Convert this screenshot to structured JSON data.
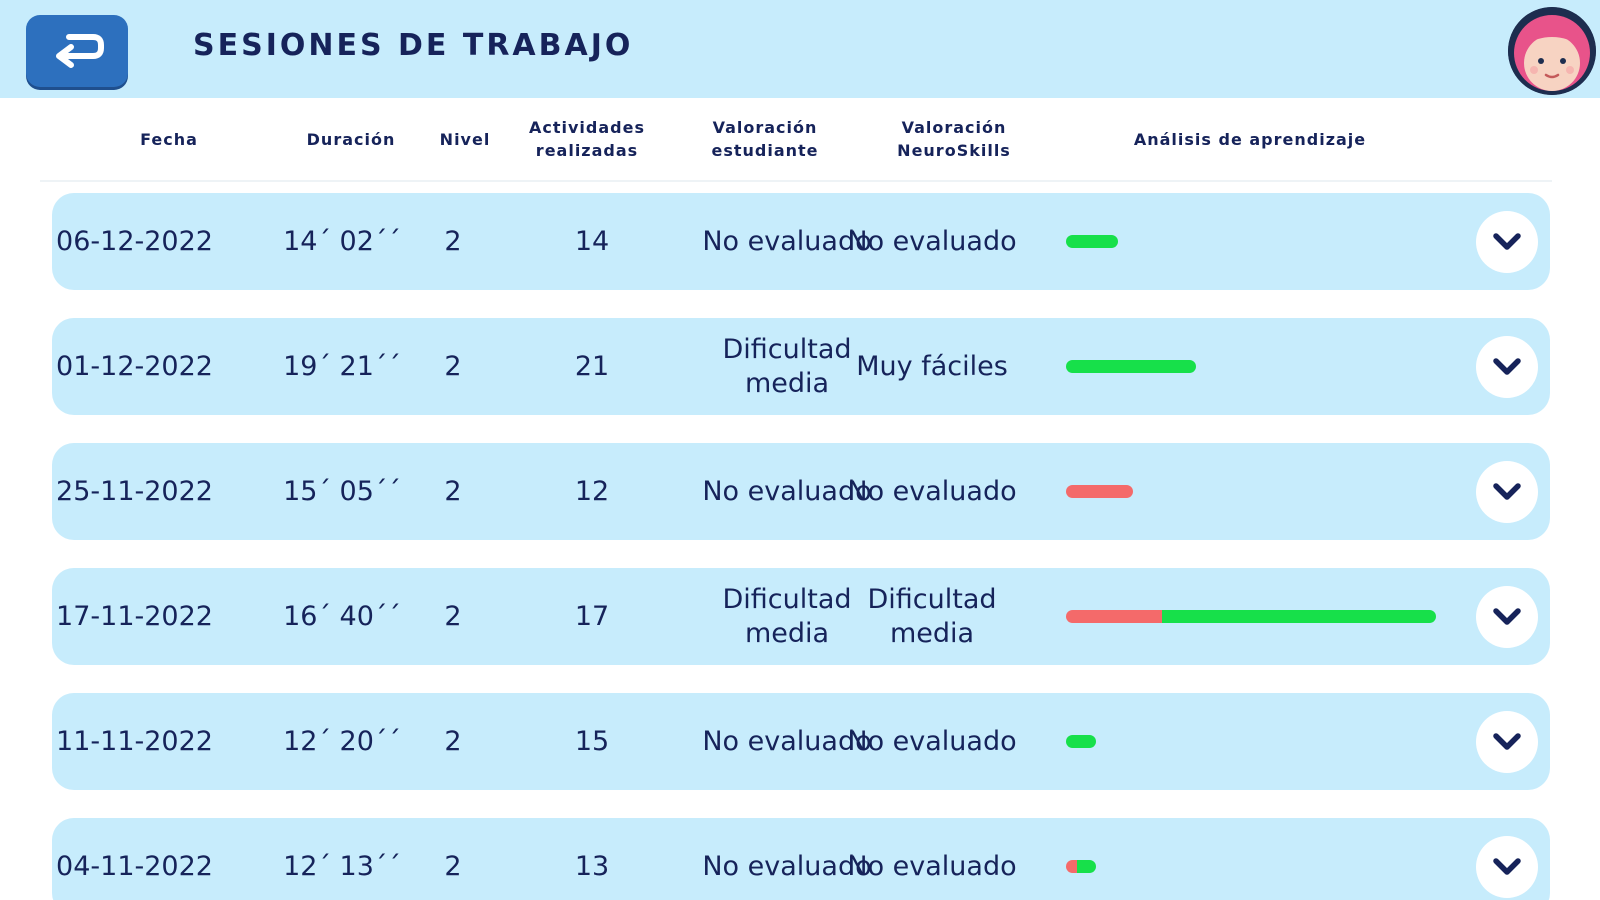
{
  "header": {
    "title": "SESIONES DE TRABAJO",
    "back_icon": "return-arrow-icon",
    "avatar_icon": "girl-avatar-icon"
  },
  "columns": {
    "fecha": "Fecha",
    "duracion": "Duración",
    "nivel": "Nivel",
    "actividades": "Actividades realizadas",
    "valoracion_estudiante": "Valoración estudiante",
    "valoracion_neuroskills": "Valoración NeuroSkills",
    "analisis": "Análisis de aprendizaje"
  },
  "colors": {
    "header_bg": "#c7ecfc",
    "row_bg": "#c7ecfc",
    "accent_blue": "#2d70be",
    "text": "#16235a",
    "bar_green": "#17e04a",
    "bar_red": "#f46a6a"
  },
  "sessions": [
    {
      "fecha": "06-12-2022",
      "duracion": "14´ 02´´",
      "nivel": "2",
      "actividades": "14",
      "val_estudiante": "No evaluado",
      "val_neuroskills": "No evaluado",
      "analysis_red": 0.0,
      "analysis_green": 0.14
    },
    {
      "fecha": "01-12-2022",
      "duracion": "19´ 21´´",
      "nivel": "2",
      "actividades": "21",
      "val_estudiante": "Dificultad media",
      "val_neuroskills": "Muy fáciles",
      "analysis_red": 0.0,
      "analysis_green": 0.35
    },
    {
      "fecha": "25-11-2022",
      "duracion": "15´ 05´´",
      "nivel": "2",
      "actividades": "12",
      "val_estudiante": "No evaluado",
      "val_neuroskills": "No evaluado",
      "analysis_red": 0.18,
      "analysis_green": 0.0
    },
    {
      "fecha": "17-11-2022",
      "duracion": "16´ 40´´",
      "nivel": "2",
      "actividades": "17",
      "val_estudiante": "Dificultad media",
      "val_neuroskills": "Dificultad media",
      "analysis_red": 0.26,
      "analysis_green": 0.74
    },
    {
      "fecha": "11-11-2022",
      "duracion": "12´ 20´´",
      "nivel": "2",
      "actividades": "15",
      "val_estudiante": "No evaluado",
      "val_neuroskills": "No evaluado",
      "analysis_red": 0.0,
      "analysis_green": 0.08
    },
    {
      "fecha": "04-11-2022",
      "duracion": "12´ 13´´",
      "nivel": "2",
      "actividades": "13",
      "val_estudiante": "No evaluado",
      "val_neuroskills": "No evaluado",
      "analysis_red": 0.03,
      "analysis_green": 0.05
    }
  ],
  "expand_icon": "chevron-down-icon"
}
